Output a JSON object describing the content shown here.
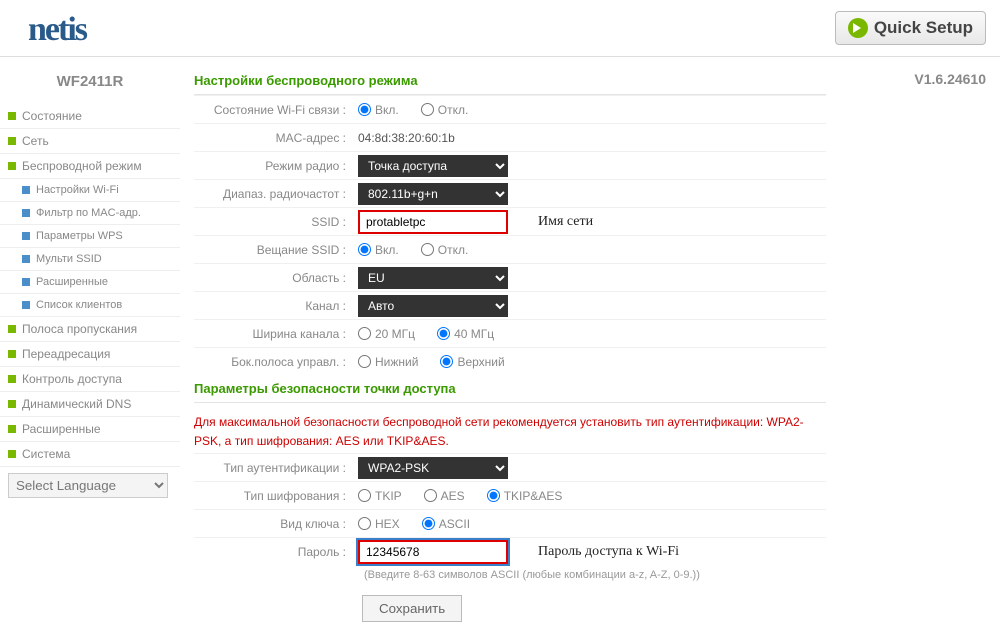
{
  "header": {
    "logo": "netis",
    "quick_setup": "Quick Setup"
  },
  "model": "WF2411R",
  "version": "V1.6.24610",
  "menu": {
    "status": "Состояние",
    "network": "Сеть",
    "wireless": "Беспроводной режим",
    "sub": {
      "wifi": "Настройки Wi-Fi",
      "mac": "Фильтр по MAC-адр.",
      "wps": "Параметры WPS",
      "mssid": "Мульти SSID",
      "adv": "Расширенные",
      "clients": "Список клиентов"
    },
    "bandwidth": "Полоса пропускания",
    "forwarding": "Переадресация",
    "access": "Контроль доступа",
    "ddns": "Динамический DNS",
    "advanced": "Расширенные",
    "system": "Система",
    "lang": "Select Language"
  },
  "section1": "Настройки беспроводного режима",
  "section2": "Параметры безопасности точки доступа",
  "warning": "Для максимальной безопасности беспроводной сети рекомендуется установить тип аутентификации: WPA2-PSK, а тип шифрования: AES или TKIP&AES.",
  "form": {
    "wifi_state_l": "Состояние Wi-Fi связи :",
    "on": "Вкл.",
    "off": "Откл.",
    "mac_l": "MAC-адрес :",
    "mac_v": "04:8d:38:20:60:1b",
    "radio_l": "Режим радио :",
    "radio_v": "Точка доступа",
    "band_l": "Диапаз. радиочастот :",
    "band_v": "802.11b+g+n",
    "ssid_l": "SSID :",
    "ssid_v": "protabletpc",
    "ssid_annot": "Имя сети",
    "bcast_l": "Вещание SSID :",
    "region_l": "Область :",
    "region_v": "EU",
    "channel_l": "Канал :",
    "channel_v": "Авто",
    "width_l": "Ширина канала :",
    "w20": "20 МГц",
    "w40": "40 МГц",
    "sideband_l": "Бок.полоса управл. :",
    "sb_low": "Нижний",
    "sb_up": "Верхний",
    "auth_l": "Тип аутентификации :",
    "auth_v": "WPA2-PSK",
    "enc_l": "Тип шифрования :",
    "tkip": "TKIP",
    "aes": "AES",
    "tkipaes": "TKIP&AES",
    "key_l": "Вид ключа :",
    "hex": "HEX",
    "ascii": "ASCII",
    "pass_l": "Пароль :",
    "pass_v": "12345678",
    "pass_annot": "Пароль доступа к Wi-Fi",
    "pass_hint": "(Введите 8-63 символов ASCII (любые комбинации a-z, A-Z, 0-9.))",
    "save": "Сохранить"
  }
}
